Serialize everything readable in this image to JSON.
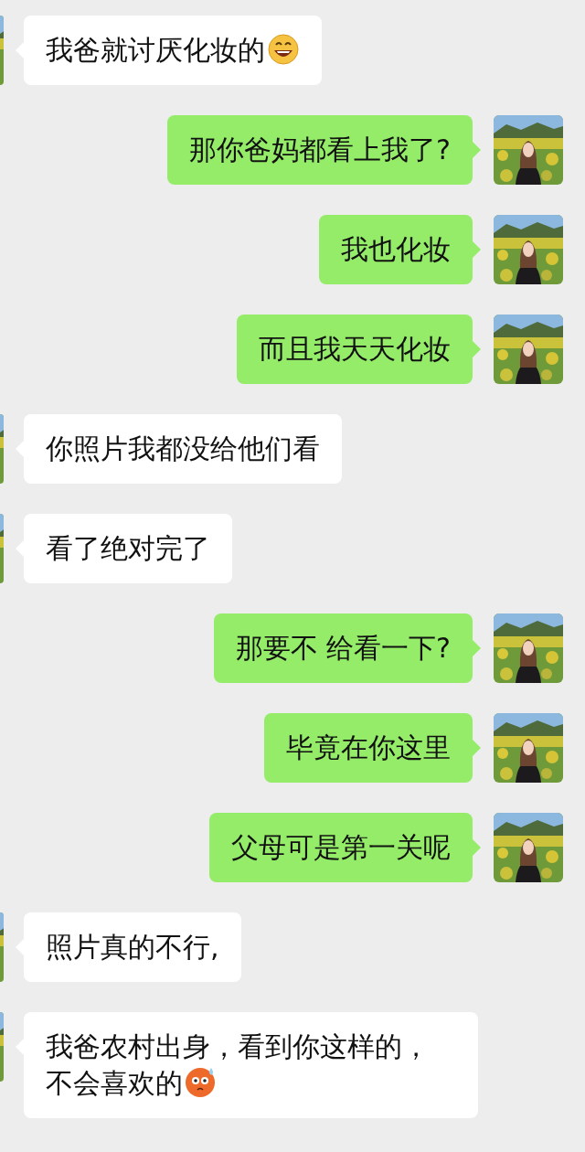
{
  "messages": [
    {
      "sent": false,
      "text": "我爸就讨厌化妆的",
      "kind": "laughing"
    },
    {
      "sent": true,
      "text": "那你爸妈都看上我了?",
      "kind": "plain"
    },
    {
      "sent": true,
      "text": "我也化妆",
      "kind": "plain"
    },
    {
      "sent": true,
      "text": "而且我天天化妆",
      "kind": "plain"
    },
    {
      "sent": false,
      "text": "你照片我都没给他们看",
      "kind": "plain"
    },
    {
      "sent": false,
      "text": "看了绝对完了",
      "kind": "plain"
    },
    {
      "sent": true,
      "text": "那要不 给看一下?",
      "kind": "plain"
    },
    {
      "sent": true,
      "text": "毕竟在你这里",
      "kind": "plain"
    },
    {
      "sent": true,
      "text": "父母可是第一关呢",
      "kind": "plain"
    },
    {
      "sent": false,
      "text": "照片真的不行,",
      "kind": "plain"
    },
    {
      "sent": false,
      "text": "我爸农村出身，看到你这样的，不会喜欢的",
      "kind": "worried"
    }
  ]
}
